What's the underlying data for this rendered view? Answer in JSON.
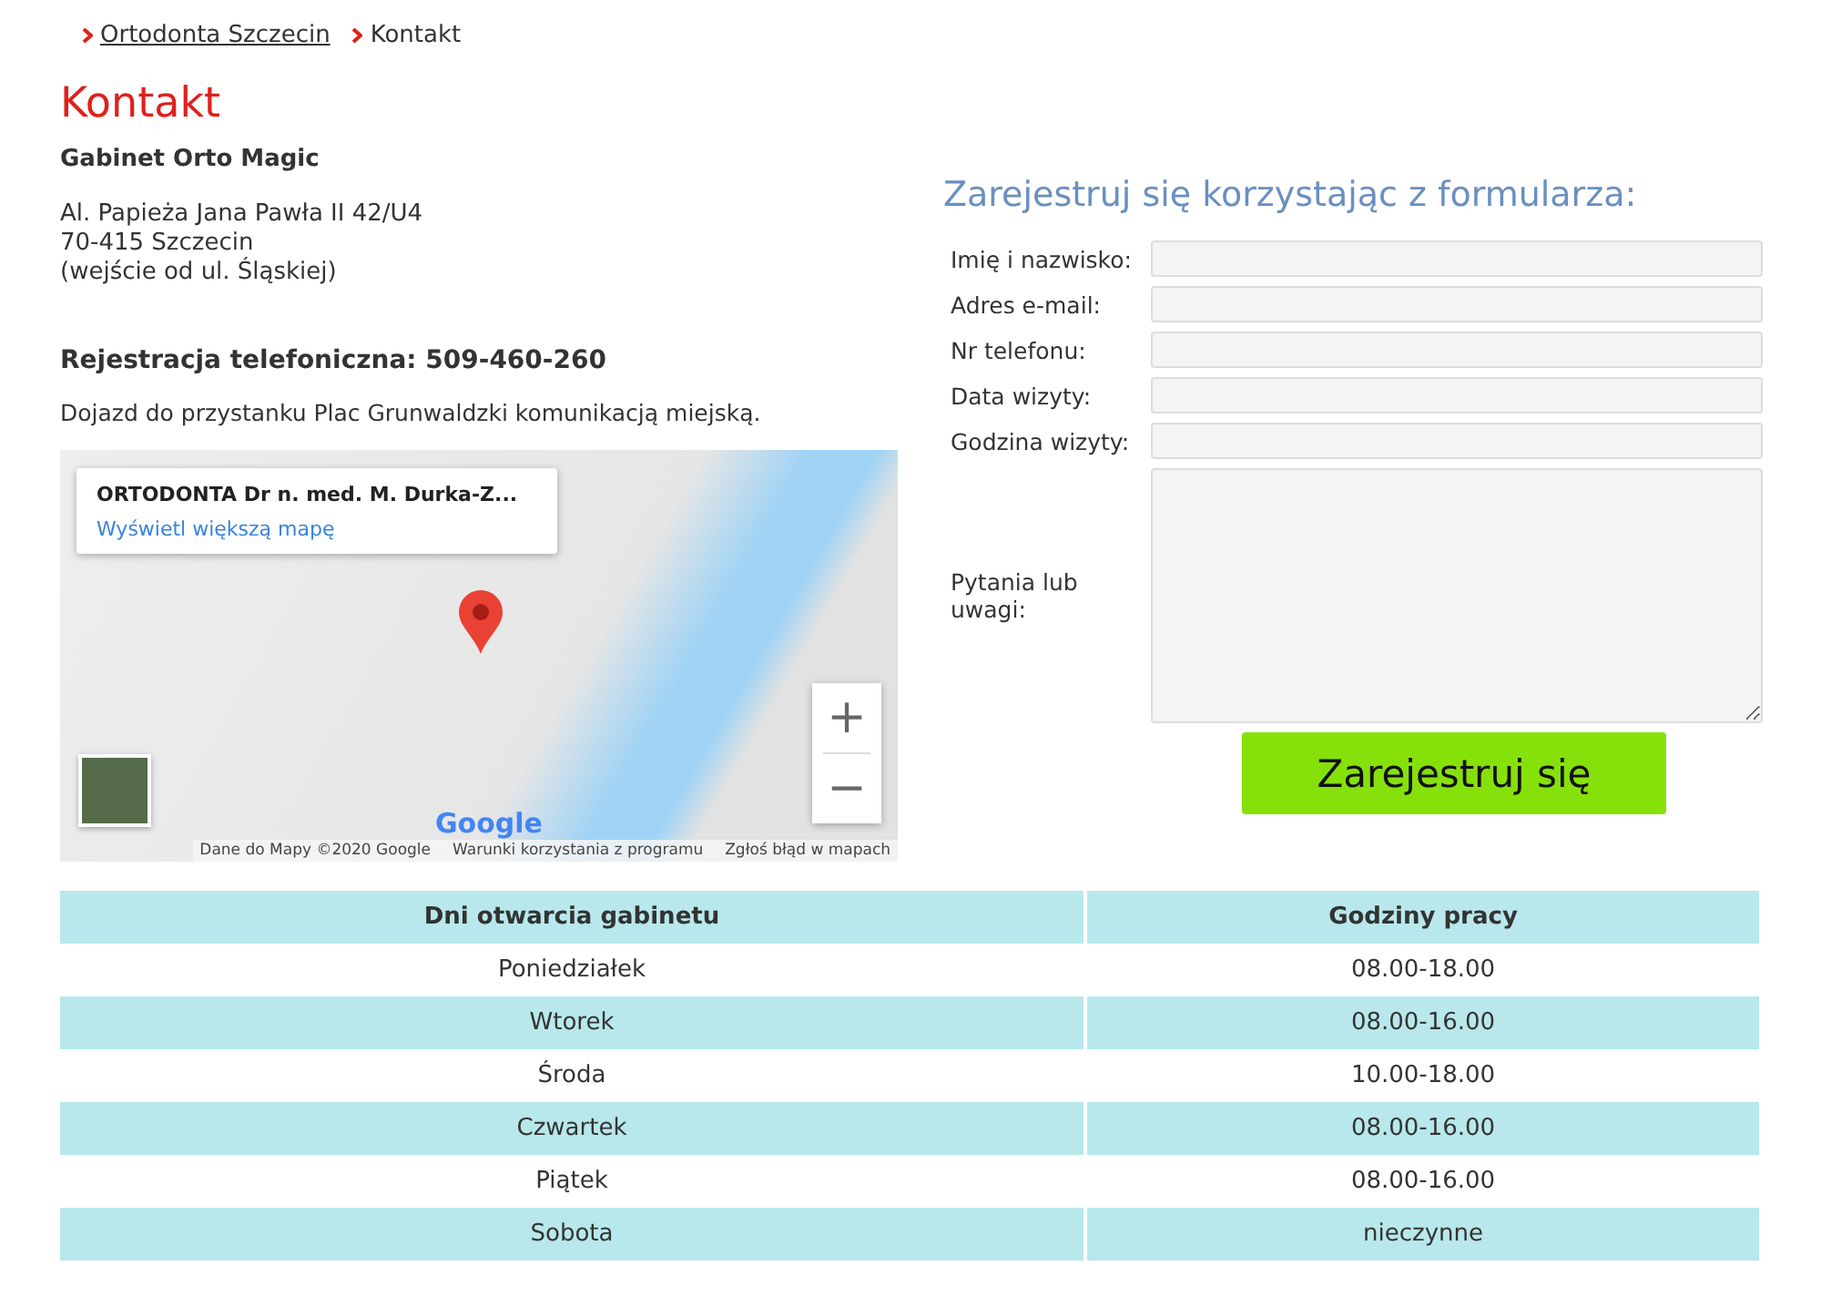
{
  "breadcrumb": [
    {
      "label": "Ortodonta Szczecin",
      "kind": "link"
    },
    {
      "label": "Kontakt",
      "kind": "current"
    }
  ],
  "title": "Kontakt",
  "clinic_name": "Gabinet Orto Magic",
  "address": [
    "Al. Papieża Jana Pawła II 42/U4",
    "70-415 Szczecin",
    "(wejście od ul. Śląskiej)"
  ],
  "phone": "Rejestracja telefoniczna: 509-460-260",
  "directions": "Dojazd do przystanku Plac Grunwaldzki komunikacją miejską.",
  "map": {
    "place_title": "ORTODONTA Dr n. med. M. Durka-Z...",
    "larger_map_link": "Wyświetl większą mapę",
    "zoom_in": "+",
    "zoom_out": "−",
    "logo": "Google",
    "footer": [
      "Dane do Mapy ©2020 Google",
      "Warunki korzystania z programu",
      "Zgłoś błąd w mapach"
    ]
  },
  "form": {
    "heading": "Zarejestruj się korzystając z formularza:",
    "fields": [
      {
        "label": "Imię i nazwisko:",
        "kind": "text"
      },
      {
        "label": "Adres e-mail:",
        "kind": "text"
      },
      {
        "label": "Nr telefonu:",
        "kind": "text"
      },
      {
        "label": "Data wizyty:",
        "kind": "text"
      },
      {
        "label": "Godzina wizyty:",
        "kind": "text"
      },
      {
        "label": "Pytania lub uwagi:",
        "kind": "textarea"
      }
    ],
    "submit": "Zarejestruj się"
  },
  "hours_table": {
    "columns": [
      "Dni otwarcia gabinetu",
      "Godziny pracy"
    ],
    "rows": [
      [
        "Poniedziałek",
        "08.00-18.00"
      ],
      [
        "Wtorek",
        "08.00-16.00"
      ],
      [
        "Środa",
        "10.00-18.00"
      ],
      [
        "Czwartek",
        "08.00-16.00"
      ],
      [
        "Piątek",
        "08.00-16.00"
      ],
      [
        "Sobota",
        "nieczynne"
      ]
    ]
  }
}
